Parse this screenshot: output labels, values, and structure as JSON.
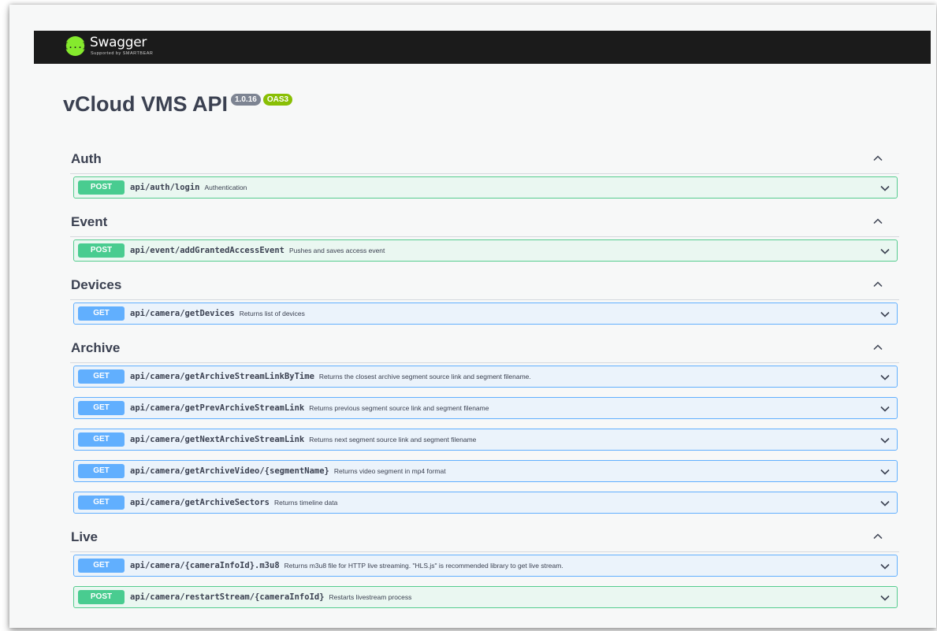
{
  "header": {
    "logo_icon_text": "{...}",
    "logo_text": "Swagger",
    "logo_subtext": "Supported by SMARTBEAR"
  },
  "info": {
    "title": "vCloud VMS API",
    "version": "1.0.16",
    "oas_badge": "OAS3"
  },
  "tags": [
    {
      "name": "Auth",
      "operations": [
        {
          "method": "POST",
          "path": "api/auth/login",
          "summary": "Authentication"
        }
      ]
    },
    {
      "name": "Event",
      "operations": [
        {
          "method": "POST",
          "path": "api/event/addGrantedAccessEvent",
          "summary": "Pushes and saves access event"
        }
      ]
    },
    {
      "name": "Devices",
      "operations": [
        {
          "method": "GET",
          "path": "api/camera/getDevices",
          "summary": "Returns list of devices"
        }
      ]
    },
    {
      "name": "Archive",
      "operations": [
        {
          "method": "GET",
          "path": "api/camera/getArchiveStreamLinkByTime",
          "summary": "Returns the closest archive segment source link and segment filename."
        },
        {
          "method": "GET",
          "path": "api/camera/getPrevArchiveStreamLink",
          "summary": "Returns previous segment source link and segment filename"
        },
        {
          "method": "GET",
          "path": "api/camera/getNextArchiveStreamLink",
          "summary": "Returns next segment source link and segment filename"
        },
        {
          "method": "GET",
          "path": "api/camera/getArchiveVideo/{segmentName}",
          "summary": "Returns video segment in mp4 format"
        },
        {
          "method": "GET",
          "path": "api/camera/getArchiveSectors",
          "summary": "Returns timeline data"
        }
      ]
    },
    {
      "name": "Live",
      "operations": [
        {
          "method": "GET",
          "path": "api/camera/{cameraInfoId}.m3u8",
          "summary": "Returns m3u8 file for HTTP live streaming. \"HLS.js\" is recommended library to get live stream."
        },
        {
          "method": "POST",
          "path": "api/camera/restartStream/{cameraInfoId}",
          "summary": "Restarts livestream process"
        }
      ]
    }
  ],
  "colors": {
    "post": "#49cc90",
    "get": "#61affe",
    "topbar": "#1b1b1b",
    "logo": "#85ea2d"
  },
  "icons": {
    "tag_toggle": "chevron-up-icon",
    "op_toggle": "chevron-down-icon"
  }
}
